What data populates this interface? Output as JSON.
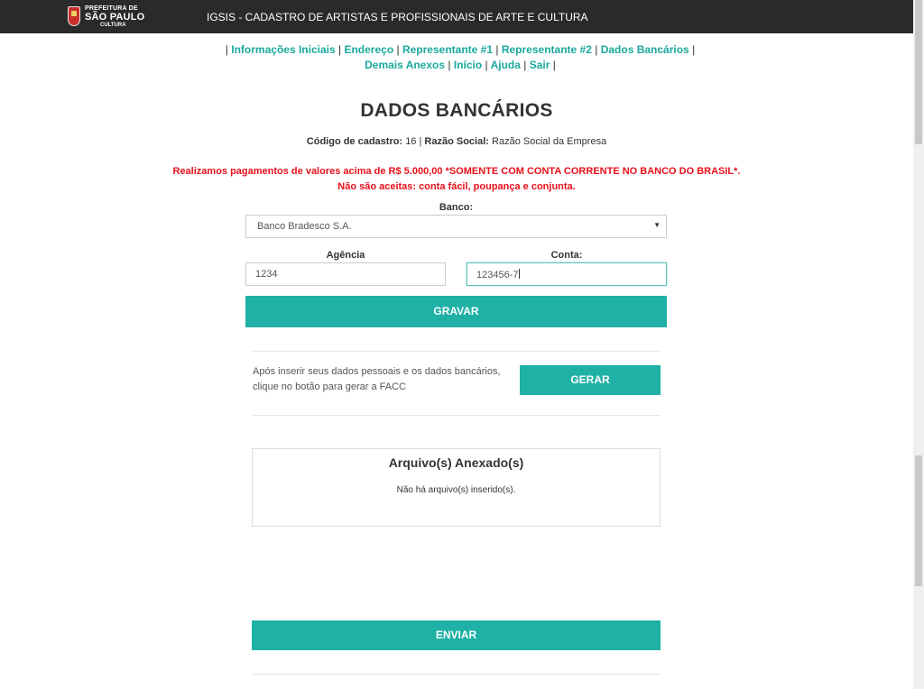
{
  "header": {
    "logo": {
      "line1": "PREFEITURA DE",
      "line2": "SÃO PAULO",
      "line3": "CULTURA"
    },
    "app_title": "IGSIS - CADASTRO DE ARTISTAS E PROFISSIONAIS DE ARTE E CULTURA"
  },
  "nav": {
    "separator": "|",
    "links": [
      "Informações Iniciais",
      "Endereço",
      "Representante #1",
      "Representante #2",
      "Dados Bancários",
      "Demais Anexos",
      "Início",
      "Ajuda",
      "Sair"
    ]
  },
  "page": {
    "title": "DADOS BANCÁRIOS",
    "code_label": "Código de cadastro:",
    "code_value": "16",
    "company_label": "Razão Social:",
    "company_value": "Razão Social da Empresa",
    "warning_line1": "Realizamos pagamentos de valores acima de R$ 5.000,00 *SOMENTE COM CONTA CORRENTE NO BANCO DO BRASIL*.",
    "warning_line2": "Não são aceitas: conta fácil, poupança e conjunta."
  },
  "form": {
    "bank_label": "Banco:",
    "bank_selected": "Banco Bradesco S.A.",
    "agency_label": "Agência",
    "agency_value": "1234",
    "account_label": "Conta:",
    "account_value": "123456-7",
    "save_label": "GRAVAR"
  },
  "facc": {
    "text_line1": "Após inserir seus dados pessoais e os dados bancários,",
    "text_line2": "clique no botão para gerar a FACC",
    "button_label": "GERAR"
  },
  "attachments": {
    "title": "Arquivo(s) Anexado(s)",
    "empty_text": "Não há arquivo(s) inserido(s)."
  },
  "send": {
    "button_label": "ENVIAR"
  },
  "colors": {
    "accent": "#1fb1a6",
    "link": "#1aa99d",
    "warning": "#e8101a",
    "topbar": "#2a2a2a"
  }
}
